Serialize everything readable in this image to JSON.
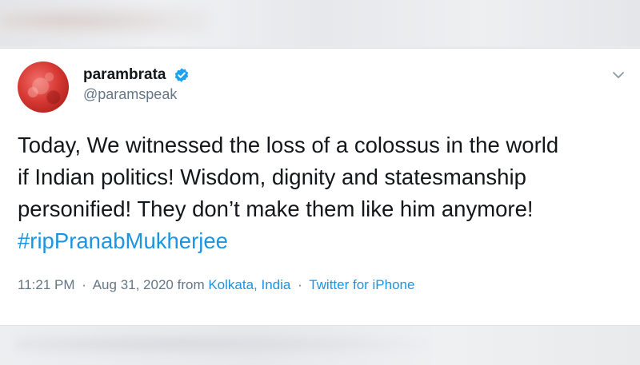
{
  "tweet": {
    "author": {
      "display_name": "parambrata",
      "handle": "@paramspeak",
      "verified_icon": "verified-badge-icon",
      "avatar_color": "#d83a34"
    },
    "text_lines": [
      "Today, We witnessed the loss of a colossus in the world",
      "if Indian politics! Wisdom, dignity and statesmanship",
      "personified! They don’t make them like him anymore!"
    ],
    "hashtag": "#ripPranabMukherjee",
    "meta": {
      "time": "11:21 PM",
      "dot1": "·",
      "date": "Aug 31, 2020",
      "from": "from",
      "location": "Kolkata, India",
      "dot2": "·",
      "source": "Twitter for iPhone"
    },
    "menu_icon": "chevron-down-icon"
  },
  "colors": {
    "link": "#1b95e0",
    "verified": "#1da1f2",
    "text": "#14171a",
    "muted": "#657786"
  }
}
